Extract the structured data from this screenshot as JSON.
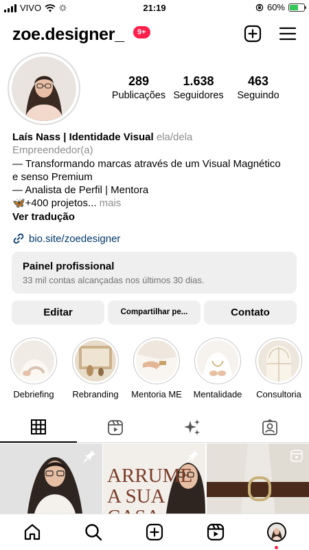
{
  "status_bar": {
    "carrier": "VIVO",
    "time": "21:19",
    "battery": "60%",
    "battery_level": 0.6
  },
  "header": {
    "username": "zoe.designer_",
    "notifications_badge": "9+"
  },
  "profile": {
    "stats": [
      {
        "value": "289",
        "label": "Publicações"
      },
      {
        "value": "1.638",
        "label": "Seguidores"
      },
      {
        "value": "463",
        "label": "Seguindo"
      }
    ],
    "name": "Laís Nass | Identidade Visual",
    "pronouns": "ela/dela",
    "category": "Empreendedor(a)",
    "bio_line1": "— Transformando marcas através de um Visual Magnético",
    "bio_line2": "e senso Premium",
    "bio_line3": "— Analista de Perfil | Mentora",
    "bio_line4": "🦋+400 projetos...",
    "more": " mais",
    "translate": "Ver tradução",
    "link": "bio.site/zoedesigner"
  },
  "panel": {
    "title": "Painel profissional",
    "subtitle": "33 mil contas alcançadas nos últimos 30 dias."
  },
  "buttons": {
    "edit": "Editar",
    "share": "Compartilhar pe...",
    "contact": "Contato"
  },
  "highlights": [
    {
      "label": "Debriefing"
    },
    {
      "label": "Rebranding"
    },
    {
      "label": "Mentoria ME"
    },
    {
      "label": "Mentalidade"
    },
    {
      "label": "Consultoria"
    }
  ],
  "tabs": [
    "grid-icon",
    "reels-icon",
    "sparkles-icon",
    "tagged-icon"
  ],
  "grid": {
    "post2_headline_line1": "ARRUME",
    "post2_headline_line2": "A SUA",
    "post2_headline_line3": "CASA"
  },
  "colors": {
    "badge": "#ff1f4b",
    "link": "#00376b",
    "button_bg": "#efefef",
    "secondary_text": "#8e8e8e",
    "battery": "#34c759"
  }
}
